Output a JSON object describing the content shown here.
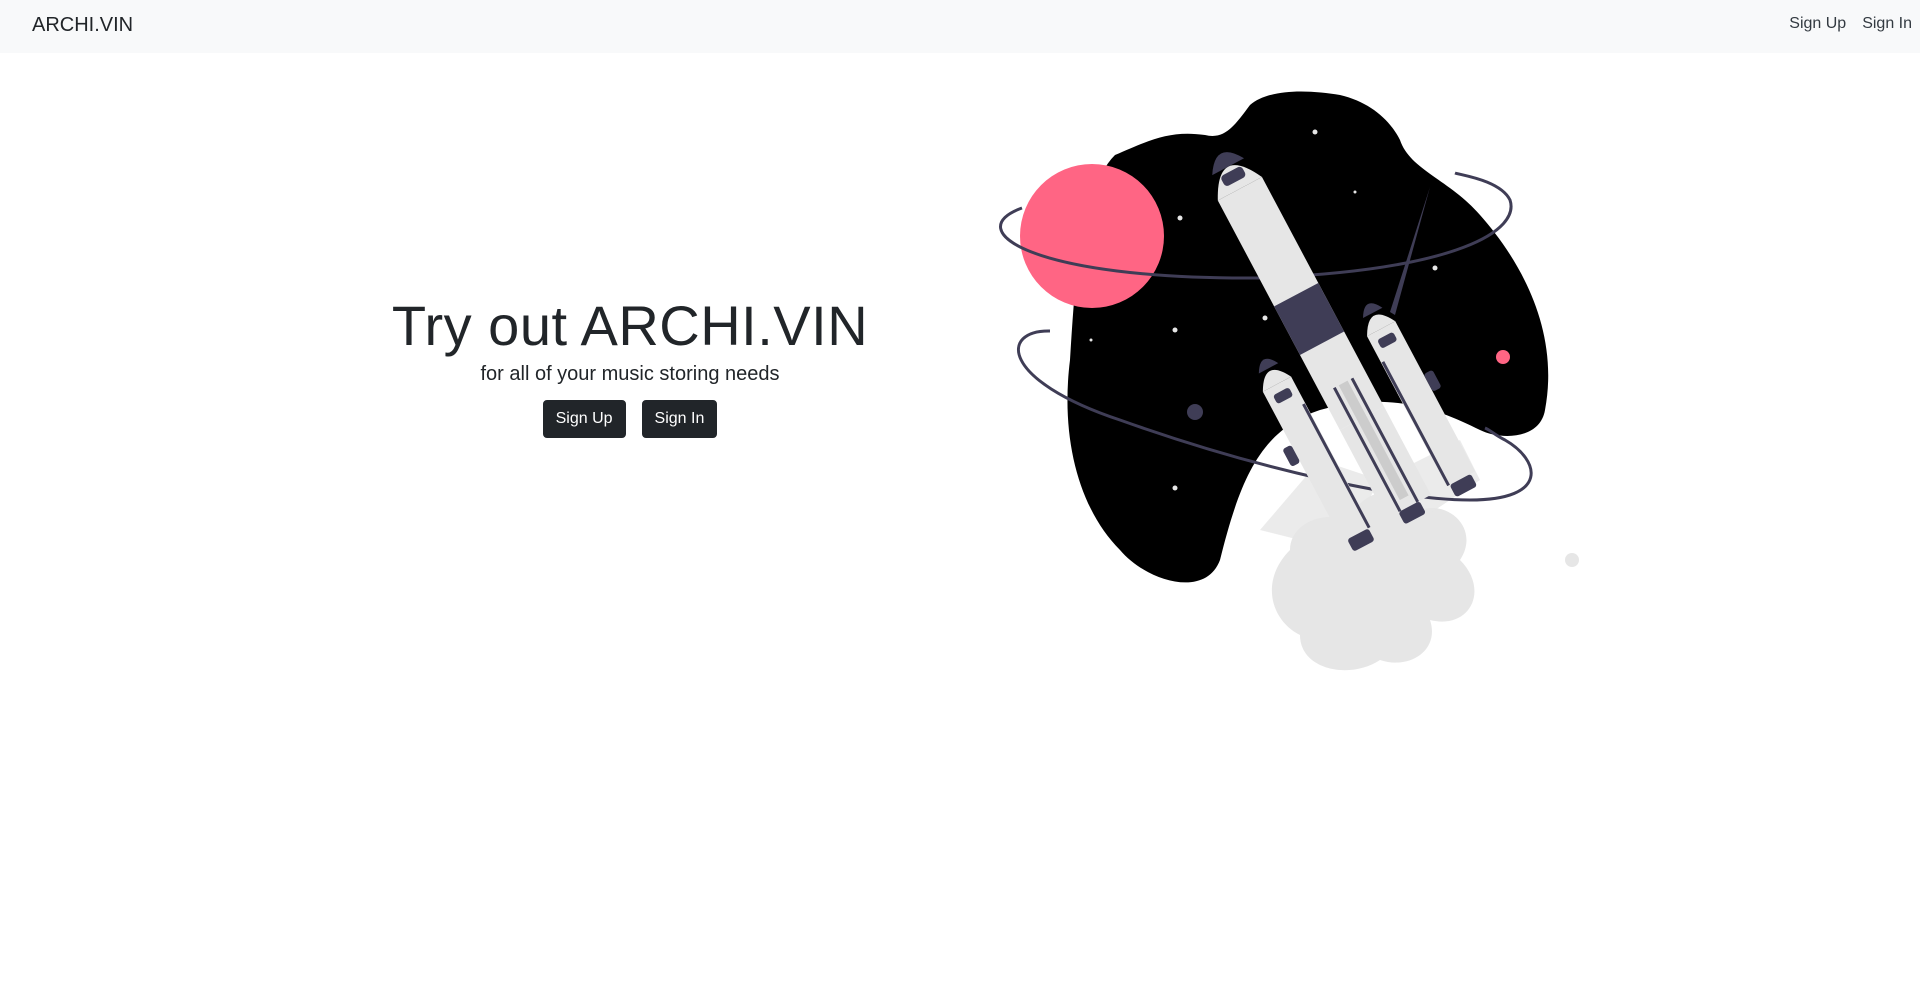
{
  "navbar": {
    "brand": "ARCHI.VIN",
    "links": [
      {
        "label": "Sign Up"
      },
      {
        "label": "Sign In"
      }
    ]
  },
  "hero": {
    "title": "Try out ARCHI.VIN",
    "subtitle": "for all of your music storing needs",
    "buttons": [
      {
        "label": "Sign Up"
      },
      {
        "label": "Sign In"
      }
    ]
  },
  "illustration": {
    "subject": "rocket-launch-in-space",
    "colors": {
      "space": "#000000",
      "planet": "#ff6584",
      "rocket_body": "#e6e6e6",
      "rocket_accent": "#3f3d56",
      "smoke": "#e6e6e6"
    }
  }
}
